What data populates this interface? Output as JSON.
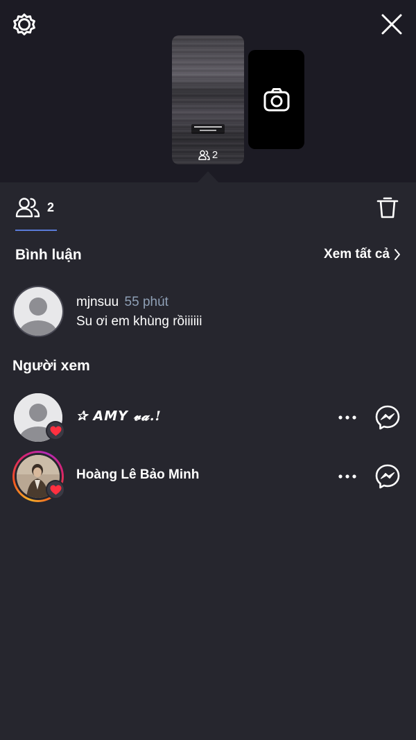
{
  "icons": {
    "settings": "gear-icon",
    "close": "close-icon",
    "camera": "camera-icon",
    "viewers": "people-icon",
    "delete": "trash-icon",
    "see_all_chevron": "chevron-right-icon",
    "heart": "heart-icon",
    "more": "more-horizontal-icon",
    "messenger": "messenger-icon"
  },
  "colors": {
    "background": "#26262e",
    "top_background": "#1c1b24",
    "tab_underline": "#5a7bd8",
    "heart": "#ff3040",
    "timestamp": "#8fa0b6"
  },
  "story": {
    "viewer_count": "2"
  },
  "tabs": {
    "viewers_count": "2"
  },
  "comments_section": {
    "title": "Bình luận",
    "see_all": "Xem tất cả",
    "items": [
      {
        "username": "mjnsuu",
        "time": "55 phút",
        "text": "Su ơi em khùng rồiiiiii"
      }
    ]
  },
  "viewers_section": {
    "title": "Người xem",
    "items": [
      {
        "name": "✰ 𝘼𝙈𝙔 𝓿𝓪.!",
        "liked": true,
        "has_story": false
      },
      {
        "name": "Hoàng Lê Bảo Minh",
        "liked": true,
        "has_story": true
      }
    ]
  }
}
